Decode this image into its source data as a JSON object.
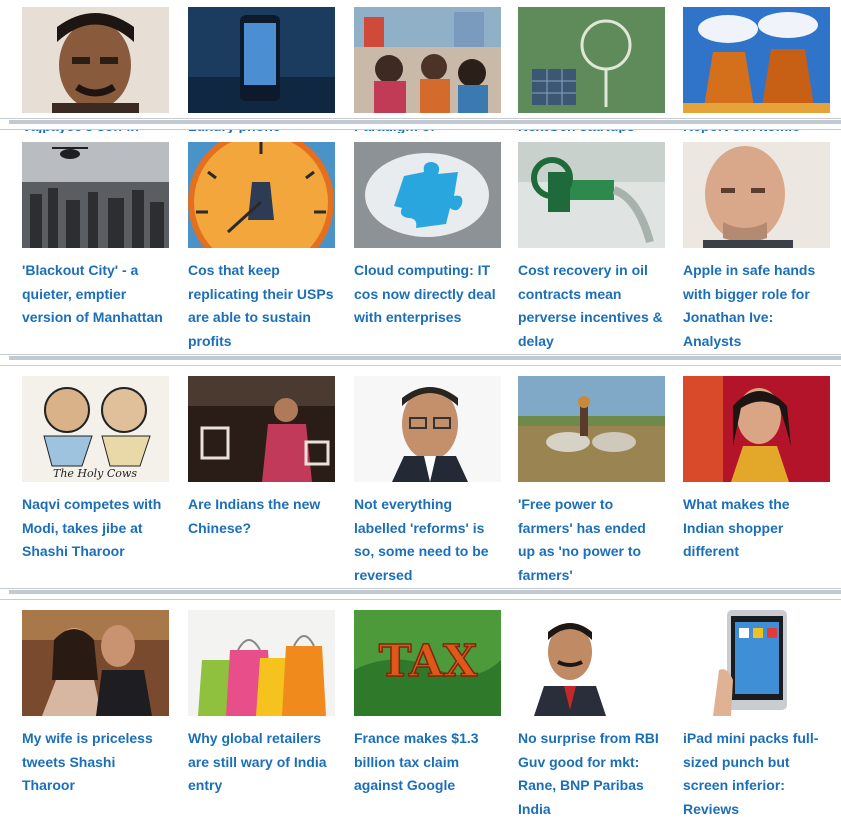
{
  "colors": {
    "link": "#1b6fb8",
    "separator": "#c3c9d2"
  },
  "rows": [
    {
      "cards": [
        {
          "title": "Vajpayee’s son-in-",
          "image": "portrait-man"
        },
        {
          "title": "Luxury phone",
          "image": "smartphone"
        },
        {
          "title": "Paradigm of",
          "image": "market-crowd"
        },
        {
          "title": "NextGen startups",
          "image": "chalkboard-tree"
        },
        {
          "title": "Report on Atomic",
          "image": "cooling-towers"
        }
      ]
    },
    {
      "cards": [
        {
          "title": "'Blackout City' - a quieter, emptier version of Manhattan",
          "image": "city-helicopter"
        },
        {
          "title": "Cos that keep replicating their USPs are able to sustain profits",
          "image": "clock"
        },
        {
          "title": "Cloud computing: IT cos now directly deal with enterprises",
          "image": "puzzle-piece"
        },
        {
          "title": "Cost recovery in oil contracts mean perverse incentives & delay",
          "image": "oil-tap"
        },
        {
          "title": "Apple in safe hands with bigger role for Jonathan Ive: Analysts",
          "image": "portrait-bald-man"
        }
      ]
    },
    {
      "cards": [
        {
          "title": "Naqvi competes with Modi, takes jibe at Shashi Tharoor",
          "image": "cartoon",
          "image_text": "The Holy Cows"
        },
        {
          "title": "Are Indians the new Chinese?",
          "image": "street-shoppers"
        },
        {
          "title": "Not everything labelled 'reforms' is so, some need to be reversed",
          "image": "portrait-glasses-man"
        },
        {
          "title": "'Free power to farmers' has ended up as 'no power to farmers'",
          "image": "farmer-oxen"
        },
        {
          "title": "What makes the Indian shopper different",
          "image": "woman-shopper"
        }
      ]
    },
    {
      "cards": [
        {
          "title": "My wife is priceless tweets Shashi Tharoor",
          "image": "couple"
        },
        {
          "title": "Why global retailers are still wary of India entry",
          "image": "shopping-bags"
        },
        {
          "title": "France makes $1.3 billion tax claim against Google",
          "image": "tax-letters",
          "image_text": "TAX"
        },
        {
          "title": "No surprise from RBI Guv good for mkt: Rane, BNP Paribas India",
          "image": "portrait-suit-man"
        },
        {
          "title": "iPad mini packs full-sized punch but screen inferior: Reviews",
          "image": "tablet"
        }
      ]
    }
  ]
}
